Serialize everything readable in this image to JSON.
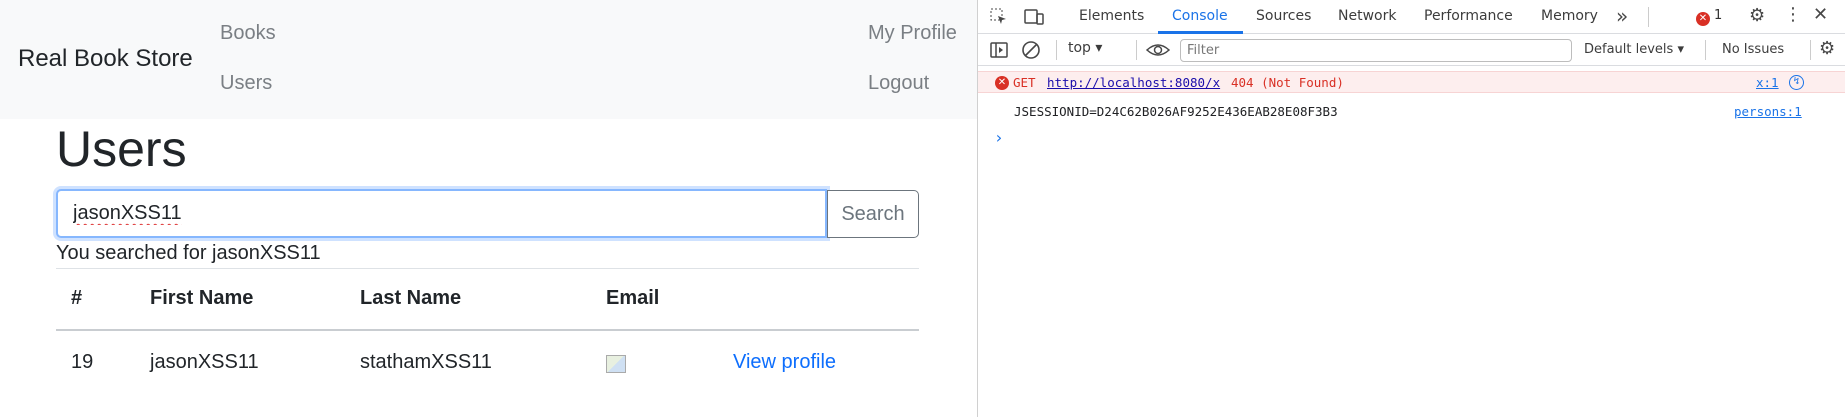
{
  "app": {
    "brand": "Real Book Store",
    "nav": {
      "books": "Books",
      "users": "Users",
      "my_profile": "My Profile",
      "logout": "Logout"
    },
    "page_title": "Users",
    "search": {
      "value": "jasonXSS11",
      "button_label": "Search"
    },
    "search_result": "You searched for jasonXSS11",
    "table": {
      "columns": [
        "#",
        "First Name",
        "Last Name",
        "Email",
        ""
      ],
      "rows": [
        {
          "id": "19",
          "first_name": "jasonXSS11",
          "last_name": "stathamXSS11",
          "email_image": "broken-image-icon",
          "link": "View profile"
        }
      ]
    },
    "colors": {
      "navbar_bg": "#f8f9fa",
      "link": "#0d6efd",
      "focus_border": "#86b7fe"
    }
  },
  "devtools": {
    "tabs": [
      "Elements",
      "Console",
      "Sources",
      "Network",
      "Performance",
      "Memory"
    ],
    "active_tab": "Console",
    "more_tabs": "»",
    "error_count": "1",
    "context": "top",
    "filter_placeholder": "Filter",
    "levels": "Default levels",
    "issues": "No Issues",
    "logs": [
      {
        "level": "error",
        "method": "GET",
        "url": "http://localhost:8080/x",
        "status": "404 (Not Found)",
        "source": "x:1"
      },
      {
        "level": "info",
        "message": "JSESSIONID=D24C62B026AF9252E436EAB28E08F3B3",
        "source": "persons:1"
      }
    ],
    "prompt": "›",
    "colors": {
      "accent": "#1a73e8",
      "error": "#d93025",
      "error_bg": "#fdeeee"
    }
  }
}
